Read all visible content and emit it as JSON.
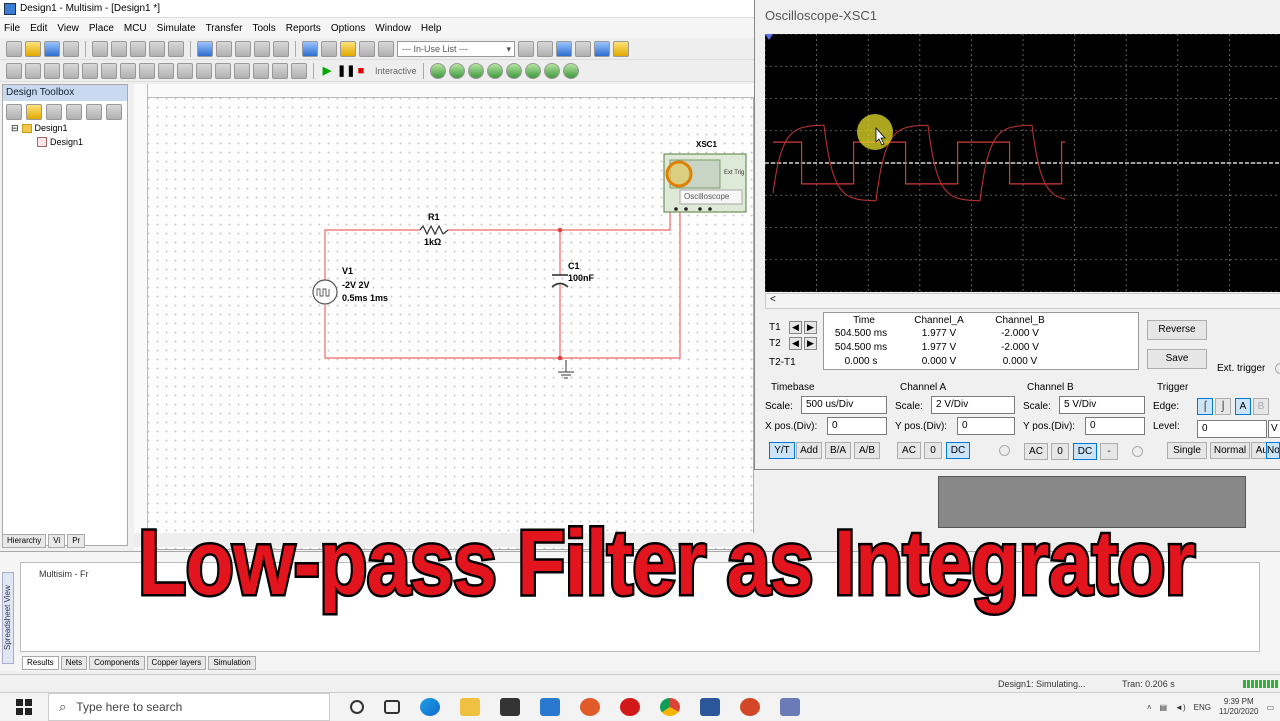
{
  "window": {
    "title": "Design1 - Multisim - [Design1 *]"
  },
  "menu": [
    "File",
    "Edit",
    "View",
    "Place",
    "MCU",
    "Simulate",
    "Transfer",
    "Tools",
    "Reports",
    "Options",
    "Window",
    "Help"
  ],
  "toolbar": {
    "in_use_list": "--- In-Use List ---",
    "mode": "Interactive"
  },
  "toolbox": {
    "title": "Design Toolbox",
    "tree": [
      {
        "label": "Design1"
      },
      {
        "label": "Design1"
      }
    ],
    "tabs": [
      "Hierarchy",
      "Vi",
      "Pr"
    ]
  },
  "schematic": {
    "resistor": {
      "ref": "R1",
      "value": "1kΩ"
    },
    "capacitor": {
      "ref": "C1",
      "value": "100nF"
    },
    "source": {
      "ref": "V1",
      "line1": "-2V 2V",
      "line2": "0.5ms 1ms"
    },
    "scope": {
      "ref": "XSC1",
      "label": "Oscilloscope",
      "ext": "Ext Trig"
    },
    "colors": {
      "wire": "#f08080",
      "ground": "#555555"
    }
  },
  "spreadsheet": {
    "side_label": "Spreadsheet View",
    "row_text": "Multisim  -  Fr",
    "tabs": [
      "Results",
      "Nets",
      "Components",
      "Copper layers",
      "Simulation"
    ]
  },
  "status": {
    "simulating": "Design1: Simulating...",
    "tran": "Tran: 0.206 s"
  },
  "oscilloscope": {
    "title": "Oscilloscope-XSC1",
    "readout": {
      "headers": [
        "Time",
        "Channel_A",
        "Channel_B"
      ],
      "rows": [
        {
          "label": "T1",
          "time": "504.500 ms",
          "a": "1.977 V",
          "b": "-2.000 V"
        },
        {
          "label": "T2",
          "time": "504.500 ms",
          "a": "1.977 V",
          "b": "-2.000 V"
        },
        {
          "label": "T2-T1",
          "time": "0.000 s",
          "a": "0.000 V",
          "b": "0.000 V"
        }
      ]
    },
    "buttons": {
      "reverse": "Reverse",
      "save": "Save",
      "ext_trigger": "Ext. trigger"
    },
    "timebase": {
      "title": "Timebase",
      "scale_label": "Scale:",
      "scale": "500 us/Div",
      "xpos_label": "X pos.(Div):",
      "xpos": "0",
      "modes": [
        "Y/T",
        "Add",
        "B/A",
        "A/B"
      ]
    },
    "channel_a": {
      "title": "Channel A",
      "scale_label": "Scale:",
      "scale": "2  V/Div",
      "ypos_label": "Y pos.(Div):",
      "ypos": "0",
      "coupling": [
        "AC",
        "0",
        "DC"
      ]
    },
    "channel_b": {
      "title": "Channel B",
      "scale_label": "Scale:",
      "scale": "5  V/Div",
      "ypos_label": "Y pos.(Div):",
      "ypos": "0",
      "coupling": [
        "AC",
        "0",
        "DC",
        "-"
      ]
    },
    "trigger": {
      "title": "Trigger",
      "edge_label": "Edge:",
      "level_label": "Level:",
      "level": "0",
      "unit": "V",
      "source": [
        "A",
        "B"
      ],
      "modes": [
        "Single",
        "Normal",
        "Auto",
        "No"
      ]
    },
    "colors": {
      "screen": "#000000",
      "grid": "#777777",
      "trace_a": "#d23a3a",
      "trace_b": "#b43232",
      "center": "#ffffff"
    }
  },
  "caption": "Low-pass Filter as Integrator",
  "taskbar": {
    "search_placeholder": "Type here to search",
    "tray": {
      "lang": "ENG",
      "time": "9:39 PM",
      "date": "11/20/2020"
    }
  }
}
